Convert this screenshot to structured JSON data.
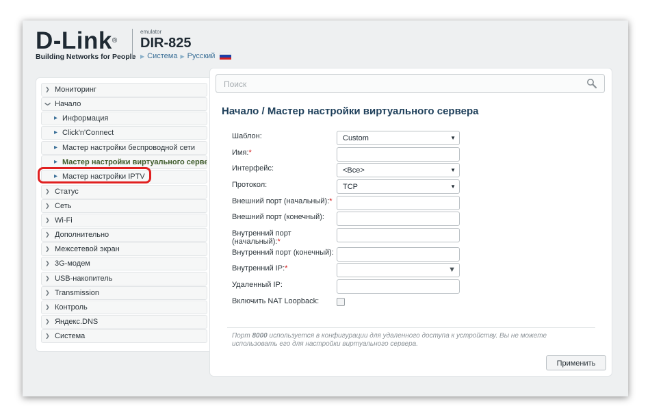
{
  "header": {
    "brand": "D-Link",
    "registered": "®",
    "tagline": "Building Networks for People",
    "emulator": "emulator",
    "model": "DIR-825",
    "links": [
      "Система",
      "Русский"
    ],
    "flag_colors": [
      "#ffffff",
      "#1c3fa8",
      "#d62020"
    ]
  },
  "sidebar": {
    "items": [
      {
        "label": "Мониторинг",
        "icon": "chevron-right-icon"
      },
      {
        "label": "Начало",
        "icon": "chevron-down-icon"
      },
      {
        "label": "Информация",
        "icon": "arrow-right-icon"
      },
      {
        "label": "Click'n'Connect",
        "icon": "arrow-right-icon"
      },
      {
        "label": "Мастер настройки беспроводной сети",
        "icon": "arrow-right-icon"
      },
      {
        "label": "Мастер настройки виртуального сервера",
        "icon": "arrow-right-icon"
      },
      {
        "label": "Мастер настройки IPTV",
        "icon": "arrow-right-icon"
      },
      {
        "label": "Статус",
        "icon": "chevron-right-icon"
      },
      {
        "label": "Сеть",
        "icon": "chevron-right-icon"
      },
      {
        "label": "Wi-Fi",
        "icon": "chevron-right-icon"
      },
      {
        "label": "Дополнительно",
        "icon": "chevron-right-icon"
      },
      {
        "label": "Межсетевой экран",
        "icon": "chevron-right-icon"
      },
      {
        "label": "3G-модем",
        "icon": "chevron-right-icon"
      },
      {
        "label": "USB-накопитель",
        "icon": "chevron-right-icon"
      },
      {
        "label": "Transmission",
        "icon": "chevron-right-icon"
      },
      {
        "label": "Контроль",
        "icon": "chevron-right-icon"
      },
      {
        "label": "Яндекс.DNS",
        "icon": "chevron-right-icon"
      },
      {
        "label": "Система",
        "icon": "chevron-right-icon"
      }
    ],
    "highlight_color": "#e02020"
  },
  "main": {
    "search_placeholder": "Поиск",
    "title": "Начало /  Мастер настройки виртуального сервера",
    "form": {
      "template_label": "Шаблон:",
      "template_value": "Custom",
      "name_label": "Имя:",
      "required_mark": "*",
      "interface_label": "Интерфейс:",
      "interface_value": "<Все>",
      "protocol_label": "Протокол:",
      "protocol_value": "TCP",
      "ext_port_start_label": "Внешний порт (начальный):",
      "ext_port_end_label": "Внешний порт (конечный):",
      "int_port_start_label_1": "Внутренний порт",
      "int_port_start_label_2": "(начальный):",
      "int_port_end_label": "Внутренний порт (конечный):",
      "int_ip_label": "Внутренний IP:",
      "remote_ip_label": "Удаленный IP:",
      "nat_loopback_label": "Включить NAT Loopback:",
      "nat_loopback_checked": false
    },
    "note_prefix": "Порт ",
    "note_port": "8000",
    "note_suffix": " используется в конфигурации для удаленного доступа к устройству. Вы не можете использовать его для настройки виртуального сервера.",
    "apply_label": "Применить"
  }
}
